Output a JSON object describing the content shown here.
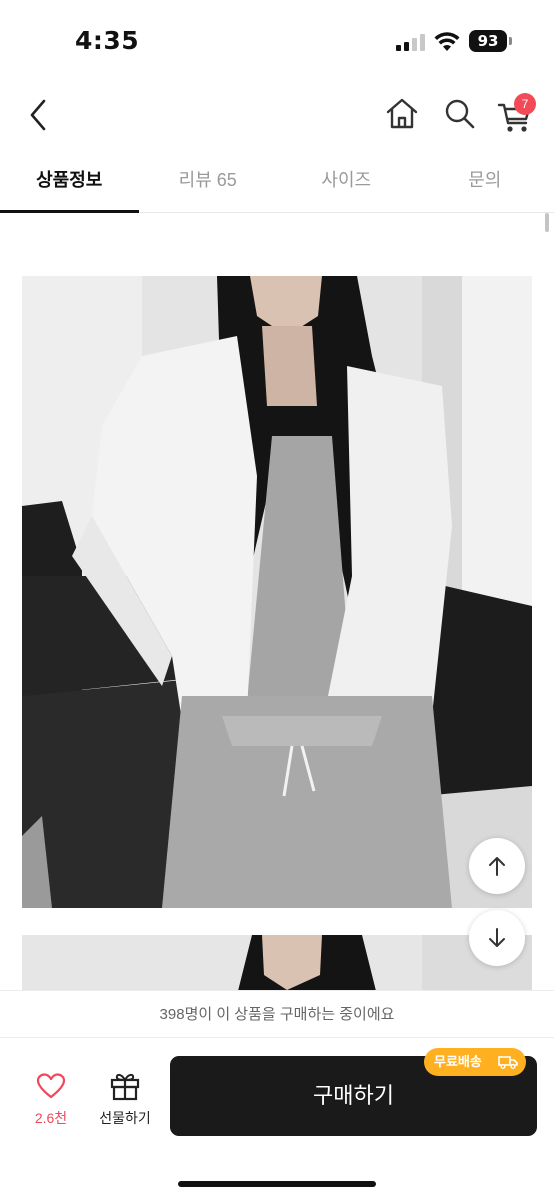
{
  "status_bar": {
    "time": "4:35",
    "battery": "93"
  },
  "nav": {
    "cart_count": "7"
  },
  "tabs": [
    {
      "label": "상품정보",
      "active": true
    },
    {
      "label": "리뷰 65",
      "active": false
    },
    {
      "label": "사이즈",
      "active": false
    },
    {
      "label": "문의",
      "active": false
    }
  ],
  "notice": {
    "text": "398명이 이 상품을 구매하는 중이에요"
  },
  "bottom_bar": {
    "like_count": "2.6천",
    "gift_label": "선물하기",
    "buy_label": "구매하기",
    "shipping_badge": "무료배송"
  },
  "colors": {
    "accent": "#f24a57",
    "buy_button": "#1a1a1a",
    "shipping_badge": "#ffb020",
    "like": "#f0485a"
  },
  "icons": [
    "back-icon",
    "home-icon",
    "search-icon",
    "cart-icon",
    "arrow-up-icon",
    "arrow-down-icon",
    "heart-icon",
    "gift-icon",
    "truck-icon"
  ]
}
